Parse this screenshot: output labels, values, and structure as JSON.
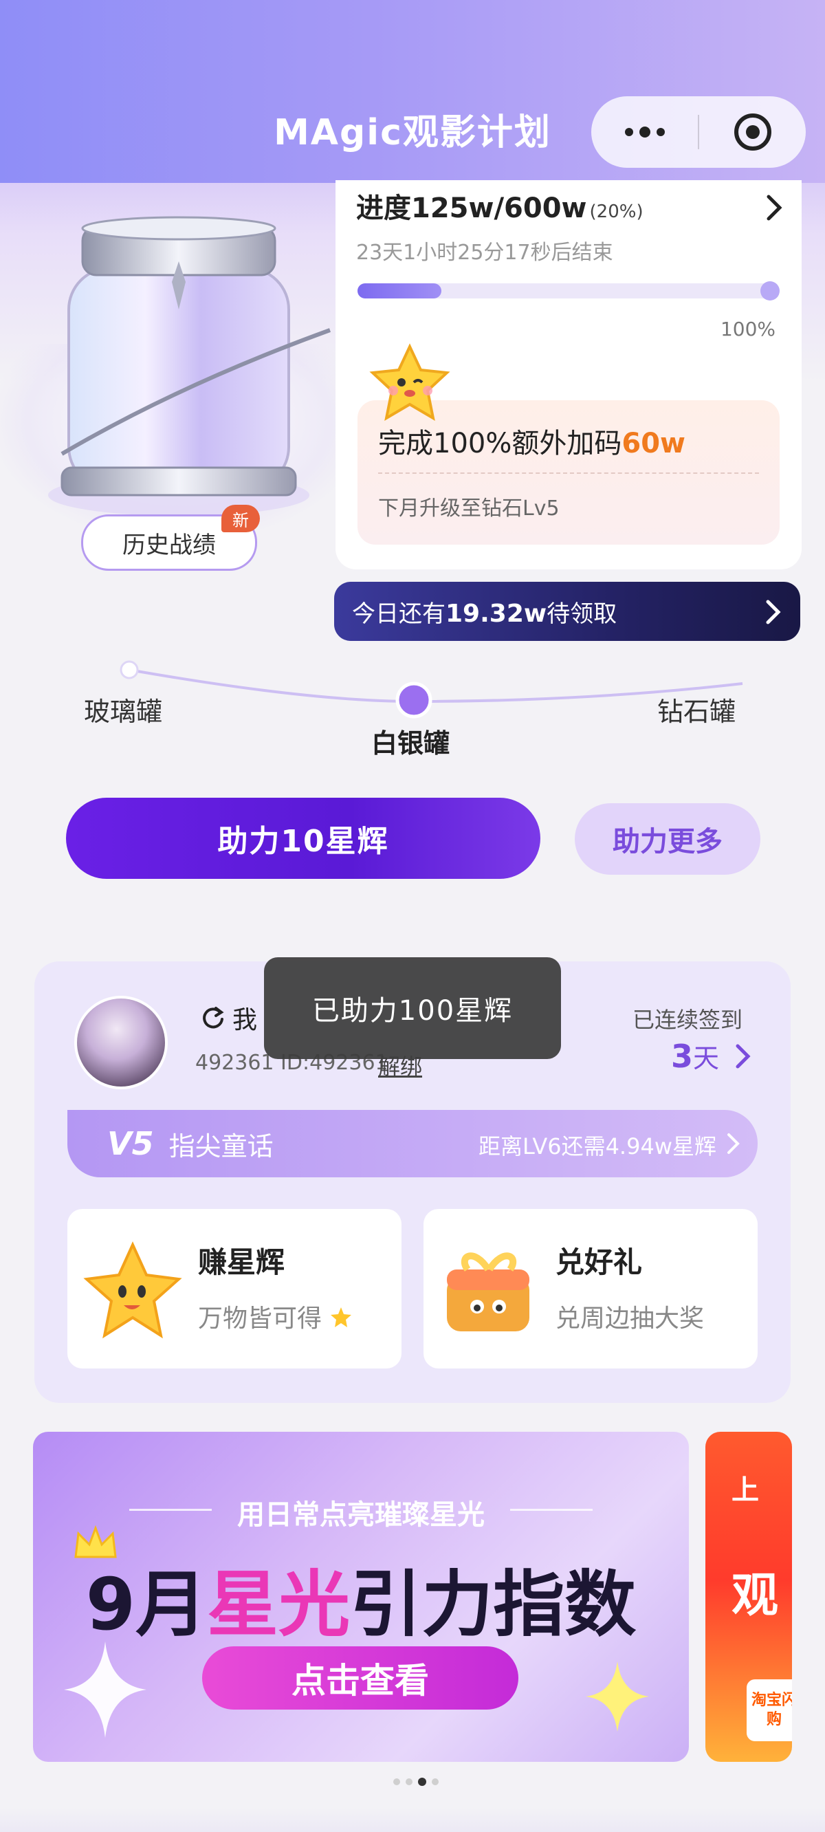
{
  "header": {
    "title": "MAgic观影计划"
  },
  "jar": {
    "history_label": "历史战绩",
    "new_badge": "新"
  },
  "progress": {
    "label": "进度",
    "value": "125w/600w",
    "percent_text": "(20%)",
    "fraction": 0.2,
    "countdown": "23天1小时25分17秒后结束",
    "end_label": "100%",
    "bonus_prefix": "完成100%额外加码",
    "bonus_value": "60w",
    "upgrade_note": "下月升级至钻石Lv5"
  },
  "today": {
    "prefix": "今日还有",
    "amount": "19.32w",
    "suffix": "待领取"
  },
  "levels": [
    {
      "label": "玻璃罐"
    },
    {
      "label": "白银罐"
    },
    {
      "label": "钻石罐"
    }
  ],
  "actions": {
    "boost_label": "助力10星辉",
    "boost_max_label": "助力更多"
  },
  "toast": {
    "text": "已助力100星辉"
  },
  "member": {
    "name_prefix": "我",
    "id_text": "492361 ID:492361",
    "unbind_label": "解绑",
    "streak_label": "已连续签到",
    "streak_days": "3",
    "streak_unit": "天",
    "level_badge": "V5",
    "level_name": "指尖童话",
    "next_level_text": "距离LV6还需4.94w星辉"
  },
  "features": [
    {
      "title": "赚星辉",
      "desc": "万物皆可得"
    },
    {
      "title": "兑好礼",
      "desc": "兑周边抽大奖"
    }
  ],
  "banner": {
    "subtitle": "用日常点亮璀璨星光",
    "title_pre": "9月",
    "title_highlight": "星光",
    "title_post": "引力指数",
    "cta": "点击查看"
  },
  "banner2": {
    "line1": "上",
    "line2": "观",
    "tag": "淘宝闪购"
  },
  "carousel": {
    "count": 4,
    "active_index": 2
  },
  "colors": {
    "accent": "#6a20e6",
    "brand_purple": "#7a4cdc",
    "toast_bg": "#3c3c3c"
  }
}
